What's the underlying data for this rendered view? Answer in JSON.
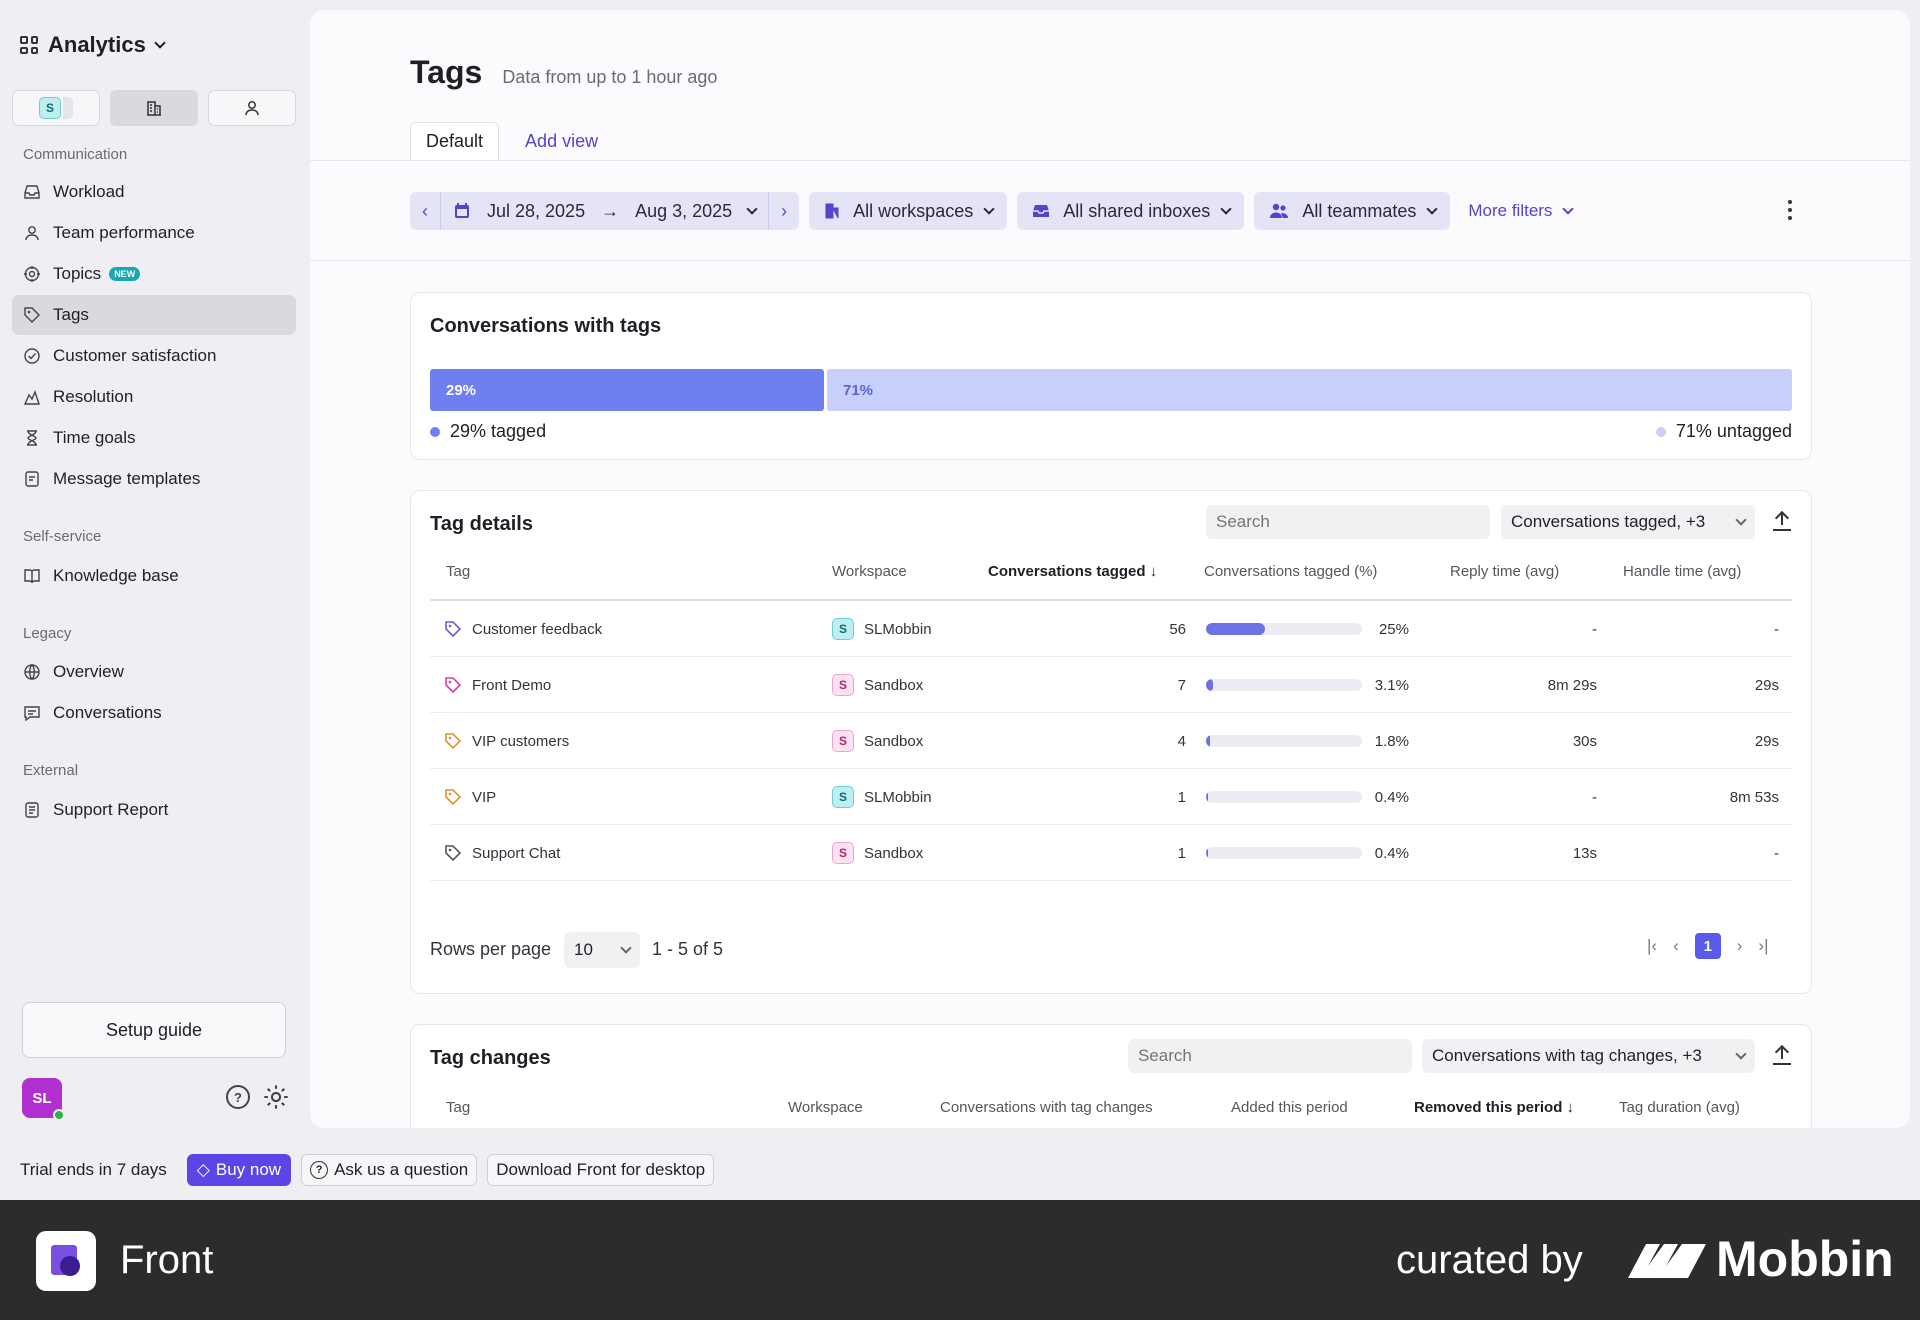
{
  "sidebar": {
    "app_title": "Analytics",
    "scope_tabs": [
      {
        "badge": "S"
      }
    ],
    "sections": [
      {
        "label": "Communication",
        "items": [
          {
            "label": "Workload",
            "icon": "inbox-icon"
          },
          {
            "label": "Team performance",
            "icon": "person-icon"
          },
          {
            "label": "Topics",
            "icon": "target-icon",
            "badge": "NEW"
          },
          {
            "label": "Tags",
            "icon": "tag-icon",
            "active": true
          },
          {
            "label": "Customer satisfaction",
            "icon": "check-badge-icon"
          },
          {
            "label": "Resolution",
            "icon": "resolution-icon"
          },
          {
            "label": "Time goals",
            "icon": "hourglass-icon"
          },
          {
            "label": "Message templates",
            "icon": "template-icon"
          }
        ]
      },
      {
        "label": "Self-service",
        "items": [
          {
            "label": "Knowledge base",
            "icon": "book-icon"
          }
        ]
      },
      {
        "label": "Legacy",
        "items": [
          {
            "label": "Overview",
            "icon": "globe-icon"
          },
          {
            "label": "Conversations",
            "icon": "chat-icon"
          }
        ]
      },
      {
        "label": "External",
        "items": [
          {
            "label": "Support Report",
            "icon": "report-icon"
          }
        ]
      }
    ],
    "setup_guide": "Setup guide",
    "avatar_initials": "SL"
  },
  "header": {
    "title": "Tags",
    "subtitle": "Data from up to 1 hour ago",
    "tabs": [
      {
        "label": "Default"
      },
      {
        "label": "Add view"
      }
    ]
  },
  "filters": {
    "date_start": "Jul 28, 2025",
    "date_end": "Aug 3, 2025",
    "workspaces": "All workspaces",
    "inboxes": "All shared inboxes",
    "teammates": "All teammates",
    "more": "More filters"
  },
  "tagged_card": {
    "title": "Conversations with tags",
    "tagged_pct": 29,
    "untagged_pct": 71,
    "tagged_bar_label": "29%",
    "untagged_bar_label": "71%",
    "tagged_legend": "29% tagged",
    "untagged_legend": "71% untagged",
    "colors": {
      "tagged": "#6f7ff0",
      "untagged": "#c8cffb"
    }
  },
  "tag_details": {
    "title": "Tag details",
    "search_placeholder": "Search",
    "columns_select": "Conversations tagged, +3",
    "headers": {
      "tag": "Tag",
      "workspace": "Workspace",
      "tagged": "Conversations tagged",
      "tagged_pct": "Conversations tagged (%)",
      "reply": "Reply time (avg)",
      "handle": "Handle time (avg)"
    },
    "rows": [
      {
        "tag": "Customer feedback",
        "tag_color": "#6b5bd6",
        "ws_badge": "S",
        "ws_type": "teal",
        "workspace": "SLMobbin",
        "count": "56",
        "pct_label": "25%",
        "pct": 25,
        "reply": "-",
        "handle": "-"
      },
      {
        "tag": "Front Demo",
        "tag_color": "#d6409f",
        "ws_badge": "S",
        "ws_type": "pink",
        "workspace": "Sandbox",
        "count": "7",
        "pct_label": "3.1%",
        "pct": 3.1,
        "reply": "8m 29s",
        "handle": "29s"
      },
      {
        "tag": "VIP customers",
        "tag_color": "#d9962b",
        "ws_badge": "S",
        "ws_type": "pink",
        "workspace": "Sandbox",
        "count": "4",
        "pct_label": "1.8%",
        "pct": 1.8,
        "reply": "30s",
        "handle": "29s"
      },
      {
        "tag": "VIP",
        "tag_color": "#d9962b",
        "ws_badge": "S",
        "ws_type": "teal",
        "workspace": "SLMobbin",
        "count": "1",
        "pct_label": "0.4%",
        "pct": 0.4,
        "reply": "-",
        "handle": "8m 53s"
      },
      {
        "tag": "Support Chat",
        "tag_color": "#555560",
        "ws_badge": "S",
        "ws_type": "pink",
        "workspace": "Sandbox",
        "count": "1",
        "pct_label": "0.4%",
        "pct": 0.4,
        "reply": "13s",
        "handle": "-"
      }
    ],
    "rows_per_page_label": "Rows per page",
    "rows_per_page": "10",
    "range": "1 - 5 of 5",
    "current_page": "1"
  },
  "tag_changes": {
    "title": "Tag changes",
    "search_placeholder": "Search",
    "columns_select": "Conversations with tag changes, +3",
    "headers": {
      "tag": "Tag",
      "workspace": "Workspace",
      "changes": "Conversations with tag changes",
      "added": "Added this period",
      "removed": "Removed this period",
      "duration": "Tag duration (avg)"
    }
  },
  "trial": {
    "text": "Trial ends in 7 days",
    "buy": "Buy now",
    "ask": "Ask us a question",
    "download": "Download Front for desktop"
  },
  "brand": {
    "app_name": "Front",
    "curated_by": "curated by",
    "mobbin": "Mobbin"
  }
}
